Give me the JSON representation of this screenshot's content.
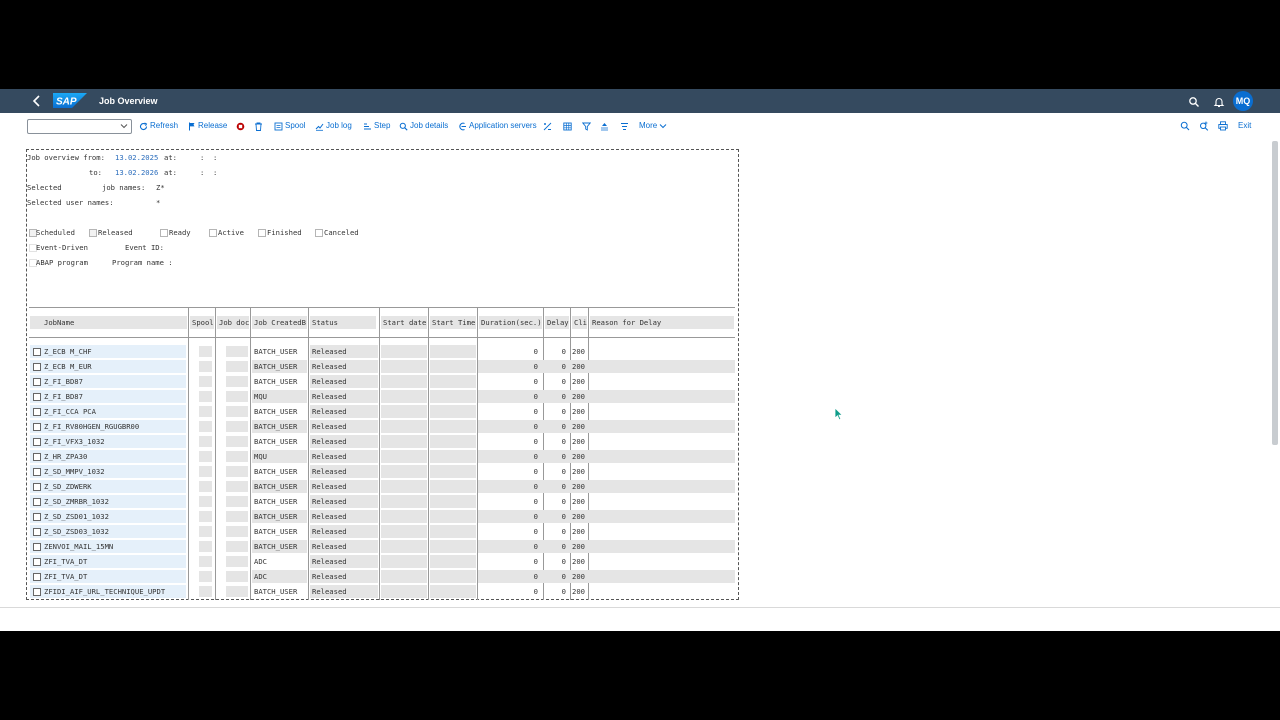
{
  "shell": {
    "title": "Job Overview",
    "logo_text": "SAP",
    "user_initials": "MQ"
  },
  "toolbar": {
    "dropdown_value": "",
    "refresh": "Refresh",
    "release": "Release",
    "spool": "Spool",
    "job_log": "Job log",
    "step": "Step",
    "job_details": "Job details",
    "application_servers": "Application servers",
    "more": "More",
    "exit": "Exit"
  },
  "report": {
    "from_label": "Job overview from:",
    "from_date": "13.02.2025",
    "at_label_1": "at:",
    "time_1": ":  :",
    "to_label": "to:",
    "to_date": "13.02.2026",
    "at_label_2": "at:",
    "time_2": ":  :",
    "selected_label": "Selected",
    "job_names_label": "job names:",
    "job_names_value": "Z*",
    "user_names_label": "Selected user names:",
    "user_names_value": "*",
    "status_filters": [
      {
        "label": "Scheduled",
        "checked": true
      },
      {
        "label": "Released",
        "checked": true
      },
      {
        "label": "Ready",
        "checked": false
      },
      {
        "label": "Active",
        "checked": false
      },
      {
        "label": "Finished",
        "checked": false
      },
      {
        "label": "Canceled",
        "checked": false
      }
    ],
    "event_driven": "Event-Driven",
    "event_id_label": "Event ID:",
    "abap_program": "ABAP program",
    "program_name_label": "Program name :"
  },
  "table": {
    "columns": [
      "JobName",
      "Spool",
      "Job doc",
      "Job CreatedB",
      "Status",
      "Start date",
      "Start Time",
      "Duration(sec.)",
      "Delay",
      "Cli",
      "Reason for Delay"
    ],
    "rows": [
      {
        "name": "Z_ECB M_CHF",
        "created_by": "BATCH_USER",
        "status": "Released",
        "duration": "0",
        "delay": "0",
        "client": "200"
      },
      {
        "name": "Z_ECB M_EUR",
        "created_by": "BATCH_USER",
        "status": "Released",
        "duration": "0",
        "delay": "0",
        "client": "200"
      },
      {
        "name": "Z_FI_BD87",
        "created_by": "BATCH_USER",
        "status": "Released",
        "duration": "0",
        "delay": "0",
        "client": "200"
      },
      {
        "name": "Z_FI_BD87",
        "created_by": "MQU",
        "status": "Released",
        "duration": "0",
        "delay": "0",
        "client": "200"
      },
      {
        "name": "Z_FI_CCA PCA",
        "created_by": "BATCH_USER",
        "status": "Released",
        "duration": "0",
        "delay": "0",
        "client": "200"
      },
      {
        "name": "Z_FI_RV80HGEN_RGUGBR00",
        "created_by": "BATCH_USER",
        "status": "Released",
        "duration": "0",
        "delay": "0",
        "client": "200"
      },
      {
        "name": "Z_FI_VFX3_1032",
        "created_by": "BATCH_USER",
        "status": "Released",
        "duration": "0",
        "delay": "0",
        "client": "200"
      },
      {
        "name": "Z_HR_ZPA30",
        "created_by": "MQU",
        "status": "Released",
        "duration": "0",
        "delay": "0",
        "client": "200"
      },
      {
        "name": "Z_SD_MMPV_1032",
        "created_by": "BATCH_USER",
        "status": "Released",
        "duration": "0",
        "delay": "0",
        "client": "200"
      },
      {
        "name": "Z_SD_ZDWERK",
        "created_by": "BATCH_USER",
        "status": "Released",
        "duration": "0",
        "delay": "0",
        "client": "200"
      },
      {
        "name": "Z_SD_ZMRBR_1032",
        "created_by": "BATCH_USER",
        "status": "Released",
        "duration": "0",
        "delay": "0",
        "client": "200"
      },
      {
        "name": "Z_SD_ZSD01_1032",
        "created_by": "BATCH_USER",
        "status": "Released",
        "duration": "0",
        "delay": "0",
        "client": "200"
      },
      {
        "name": "Z_SD_ZSD03_1032",
        "created_by": "BATCH_USER",
        "status": "Released",
        "duration": "0",
        "delay": "0",
        "client": "200"
      },
      {
        "name": "ZENVOI_MAIL_15MN",
        "created_by": "BATCH_USER",
        "status": "Released",
        "duration": "0",
        "delay": "0",
        "client": "200"
      },
      {
        "name": "ZFI_TVA_DT",
        "created_by": "ADC",
        "status": "Released",
        "duration": "0",
        "delay": "0",
        "client": "200"
      },
      {
        "name": "ZFI_TVA_DT",
        "created_by": "ADC",
        "status": "Released",
        "duration": "0",
        "delay": "0",
        "client": "200"
      },
      {
        "name": "ZFIDI_AIF_URL_TECHNIQUE_UPDT",
        "created_by": "BATCH_USER",
        "status": "Released",
        "duration": "0",
        "delay": "0",
        "client": "200"
      }
    ]
  },
  "colors": {
    "shell_bg": "#354a5f",
    "accent": "#0a6ed1",
    "cancel_red": "#bb0000"
  }
}
